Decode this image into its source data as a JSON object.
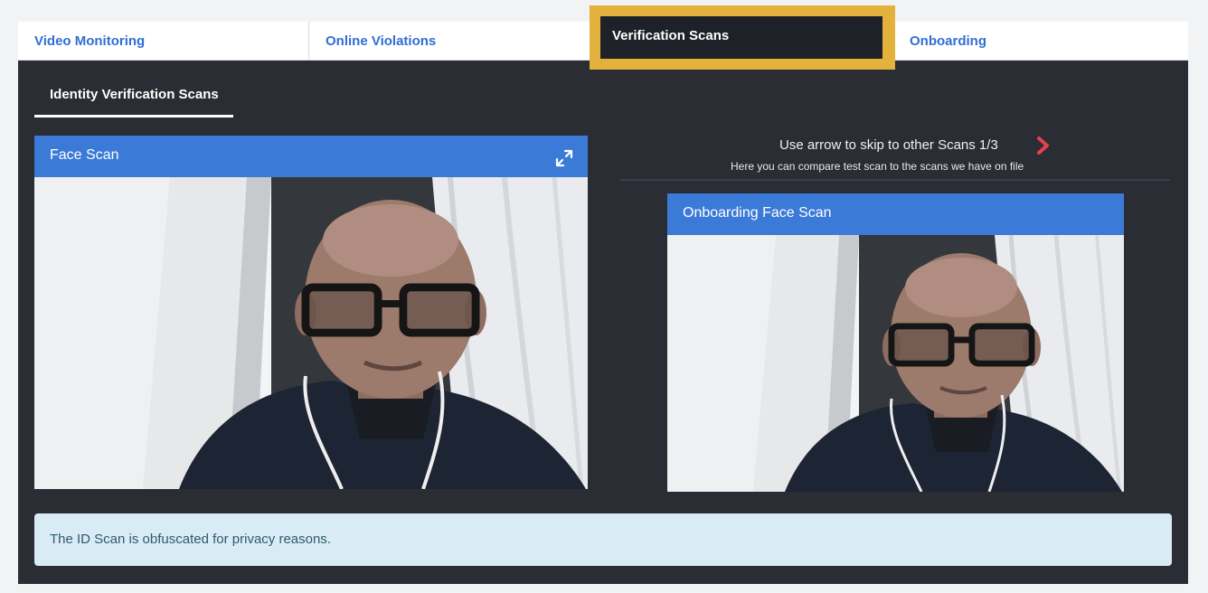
{
  "tabs": {
    "video_monitoring": "Video Monitoring",
    "online_violations": "Online Violations",
    "verification_scans": "Verification Scans",
    "onboarding": "Onboarding"
  },
  "subtab": {
    "label": "Identity Verification Scans"
  },
  "face_scan": {
    "title": "Face Scan"
  },
  "scan_nav": {
    "instruction": "Use arrow to skip to other Scans 1/3",
    "caption": "Here you can compare test scan to the scans we have on file"
  },
  "onboarding_scan": {
    "title": "Onboarding Face Scan"
  },
  "notice": {
    "text": "The ID Scan is obfuscated for privacy reasons."
  },
  "colors": {
    "accent_blue": "#3c7ad8",
    "tab_link": "#2f6fd4",
    "highlight": "#e3b23c",
    "dark_bg": "#2b2d34",
    "arrow_red": "#e0424f"
  },
  "icons": {
    "expand": "expand-icon",
    "next": "chevron-right-icon"
  }
}
